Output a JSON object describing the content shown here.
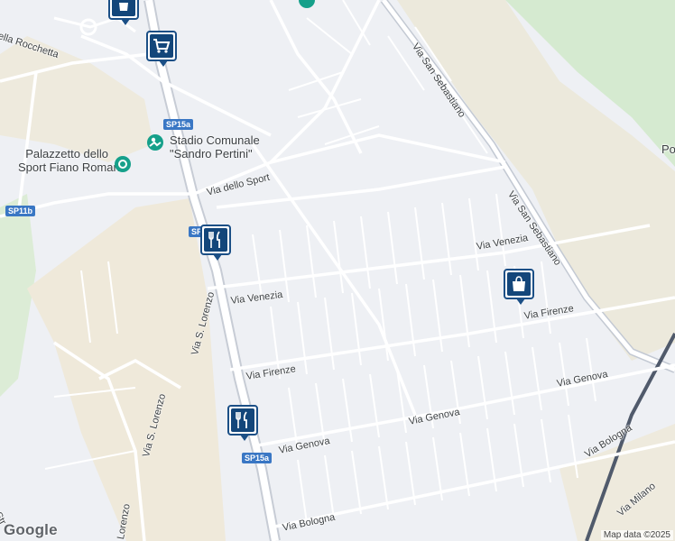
{
  "map": {
    "road_labels": [
      {
        "id": "rocchetta",
        "text": "ella Rocchetta"
      },
      {
        "id": "via-san-sebastiano-1",
        "text": "Via San Sebastiano"
      },
      {
        "id": "via-san-sebastiano-2",
        "text": "Via San Sebastiano"
      },
      {
        "id": "via-dello-sport",
        "text": "Via dello Sport"
      },
      {
        "id": "via-venezia-1",
        "text": "Via Venezia"
      },
      {
        "id": "via-venezia-2",
        "text": "Via Venezia"
      },
      {
        "id": "via-s-lorenzo-1",
        "text": "Via S. Lorenzo"
      },
      {
        "id": "via-s-lorenzo-2",
        "text": "Via S. Lorenzo"
      },
      {
        "id": "via-firenze-1",
        "text": "Via Firenze"
      },
      {
        "id": "via-firenze-2",
        "text": "Via Firenze"
      },
      {
        "id": "via-genova-1",
        "text": "Via Genova"
      },
      {
        "id": "via-genova-2",
        "text": "Via Genova"
      },
      {
        "id": "via-genova-3",
        "text": "Via Genova"
      },
      {
        "id": "via-bologna-1",
        "text": "Via Bologna"
      },
      {
        "id": "via-bologna-2",
        "text": "Via Bologna"
      },
      {
        "id": "via-milano",
        "text": "Via Milano"
      },
      {
        "id": "lorenzo-frag",
        "text": "Lorenzo"
      },
      {
        "id": "s-frag",
        "text": "Str"
      },
      {
        "id": "po-frag",
        "text": "Po"
      }
    ],
    "route_shields": [
      {
        "id": "sp15a-1",
        "text": "SP15a"
      },
      {
        "id": "sp11b",
        "text": "SP11b"
      },
      {
        "id": "sp15a-2",
        "text": "SP15"
      },
      {
        "id": "sp15a-3",
        "text": "SP15a"
      }
    ],
    "pois": [
      {
        "id": "stadio",
        "line1": "Stadio Comunale",
        "line2": "\"Sandro Pertini\"",
        "icon": "stadium-icon"
      },
      {
        "id": "palazzetto",
        "line1": "Palazzetto dello",
        "line2": "Sport Fiano Romano",
        "icon": "sports-icon"
      }
    ],
    "markers": [
      {
        "id": "shopping-cart-marker",
        "icon": "shopping-cart-icon"
      },
      {
        "id": "restaurant-marker-1",
        "icon": "restaurant-icon"
      },
      {
        "id": "restaurant-marker-2",
        "icon": "restaurant-icon"
      },
      {
        "id": "shopping-bag-marker",
        "icon": "shopping-bag-icon"
      },
      {
        "id": "top-marker",
        "icon": "shopping-bag-icon"
      }
    ],
    "branding": {
      "logo": "Google",
      "credit": "Map data ©2025"
    },
    "colors": {
      "background": "#eef0f4",
      "road": "#ffffff",
      "main_road": "#c7ccd5",
      "green_area": "#d5ead0",
      "sand_area": "#ede8d8",
      "rail": "#505a6b",
      "marker": "#13467a",
      "shield": "#3a77c4"
    }
  }
}
